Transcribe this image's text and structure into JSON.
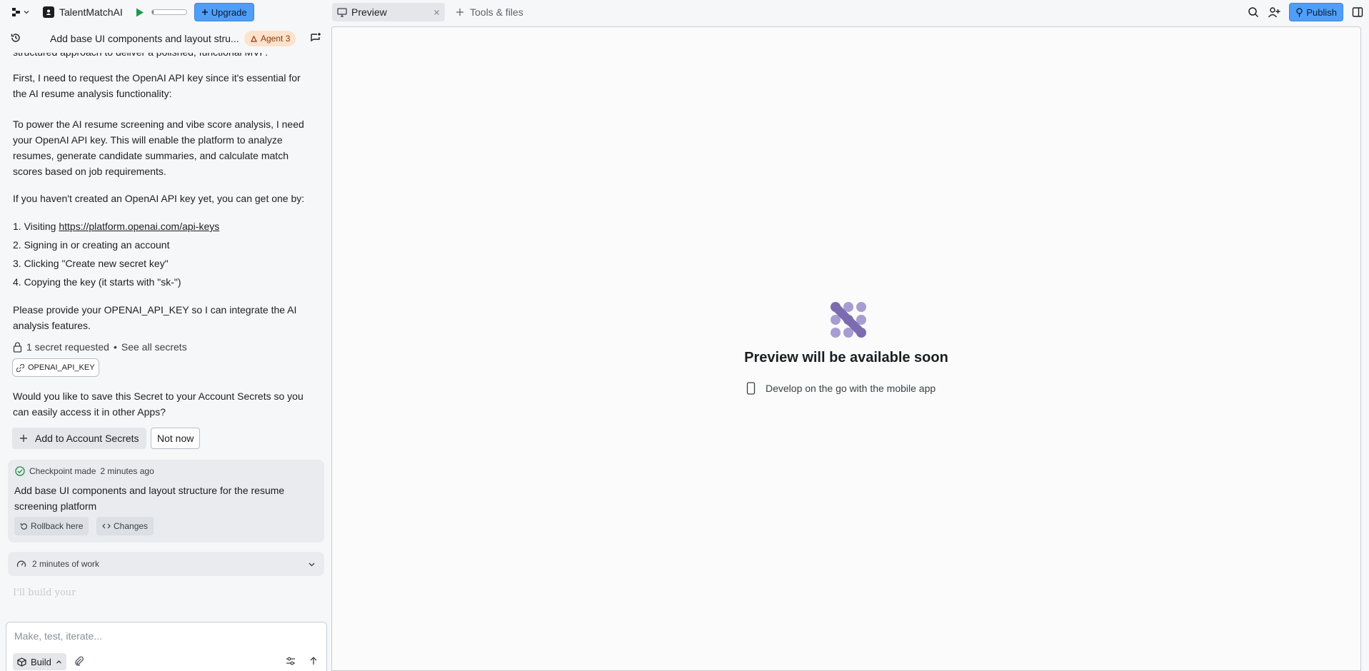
{
  "topbar": {
    "app_name": "TalentMatchAI",
    "progress_fraction": 0.05,
    "upgrade_label": "Upgrade",
    "tabs": [
      {
        "label": "Preview",
        "active": true
      },
      {
        "label": "Tools & files",
        "active": false
      }
    ],
    "publish_label": "Publish"
  },
  "chat": {
    "title": "Add base UI components and layout stru...",
    "agent_badge": "Agent 3",
    "partial_top_line": "structured approach to deliver a polished, functional MVP.",
    "p1": "First, I need to request the OpenAI API key since it's essential for the AI resume analysis functionality:",
    "p2": "To power the AI resume screening and vibe score analysis, I need your OpenAI API key. This will enable the platform to analyze resumes, generate candidate summaries, and calculate match scores based on job requirements.",
    "p3": "If you haven't created an OpenAI API key yet, you can get one by:",
    "steps": [
      {
        "prefix": "1. Visiting ",
        "link": "https://platform.openai.com/api-keys"
      },
      {
        "prefix": "2. Signing in or creating an account"
      },
      {
        "prefix": "3. Clicking \"Create new secret key\""
      },
      {
        "prefix": "4. Copying the key (it starts with \"sk-\")"
      }
    ],
    "p4": "Please provide your OPENAI_API_KEY so I can integrate the AI analysis features.",
    "secret_requested": "1 secret requested",
    "see_all": "See all secrets",
    "secret_name": "OPENAI_API_KEY",
    "save_question": "Would you like to save this Secret to your Account Secrets so you can easily access it in other Apps?",
    "add_secret_label": "Add to Account Secrets",
    "not_now_label": "Not now",
    "checkpoint": {
      "made": "Checkpoint made",
      "time": "2 minutes ago",
      "text": "Add base UI components and layout structure for the resume screening platform",
      "rollback_label": "Rollback here",
      "changes_label": "Changes"
    },
    "work_summary": "2 minutes of work",
    "streaming_text": "I'll build your"
  },
  "composer": {
    "placeholder": "Make, test, iterate...",
    "mode_label": "Build"
  },
  "preview": {
    "title": "Preview will be available soon",
    "subtitle": "Develop on the go with the mobile app"
  },
  "colors": {
    "accent_blue": "#4f9ef8",
    "agent_badge_bg": "#fde2cc",
    "logo_purple": "#7b6cb0",
    "run_green": "#1a9c4a"
  }
}
